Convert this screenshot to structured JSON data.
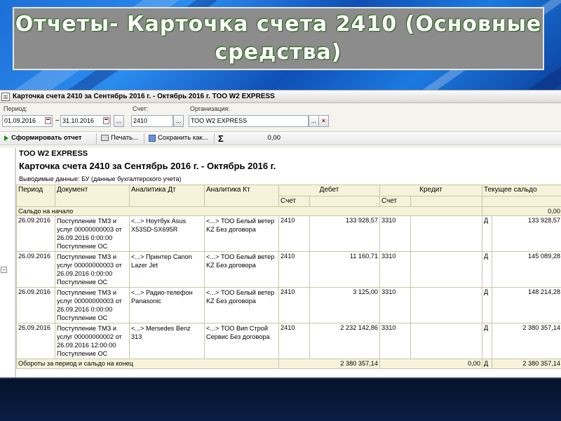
{
  "slide": {
    "title_line1": "Отчеты- Карточка счета 2410 (Основные",
    "title_line2": "средства)"
  },
  "window": {
    "title": "Карточка счета 2410 за Сентябрь 2016 г. - Октябрь 2016 г. ТОО W2 EXPRESS"
  },
  "params": {
    "period_label": "Период:",
    "date_from": "01.09.2016",
    "date_to": "31.10.2016",
    "dots_label": "...",
    "account_label": "Счет:",
    "account_value": "2410",
    "org_label": "Организация:",
    "org_value": "ТОО W2 EXPRESS",
    "clear_label": "×"
  },
  "toolbar": {
    "generate_label": "Сформировать отчет",
    "print_label": "Печать...",
    "save_label": "Сохранить как...",
    "sigma": "Σ",
    "sum_value": "0,00"
  },
  "report": {
    "org": "ТОО W2 EXPRESS",
    "title": "Карточка счета 2410 за Сентябрь 2016 г. - Октябрь 2016 г.",
    "output_data": "Выводимые данные:  БУ (данные бухгалтерского учета)",
    "headers": {
      "period": "Период",
      "document": "Документ",
      "analytics_dt": "Аналитика Дт",
      "analytics_kt": "Аналитика Кт",
      "debit": "Дебет",
      "credit": "Кредит",
      "balance": "Текущее сальдо",
      "debit_account": "Счет",
      "credit_account": "Счет"
    },
    "opening": {
      "label": "Сальдо на начало",
      "value": "0,00"
    },
    "rows": [
      {
        "date": "26.09.2016",
        "document": "Поступление ТМЗ и услуг 00000000003 от 26.09.2016 0:00:00 Поступление ОС",
        "analytics_dt": "<...> Ноутбук Asus X53SD-SX695R",
        "analytics_kt": "<...> ТОО Белый ветер KZ Без договора",
        "debit_account": "2410",
        "debit_sum": "133 928,57",
        "credit_account": "3310",
        "credit_sum": "",
        "balance_side": "Д",
        "balance": "133 928,57"
      },
      {
        "date": "26.09.2016",
        "document": "Поступление ТМЗ и услуг 00000000003 от 26.09.2016 0:00:00 Поступление ОС",
        "analytics_dt": "<...> Принтер Canon Lazer Jet",
        "analytics_kt": "<...> ТОО Белый ветер KZ Без договора",
        "debit_account": "2410",
        "debit_sum": "11 160,71",
        "credit_account": "3310",
        "credit_sum": "",
        "balance_side": "Д",
        "balance": "145 089,28"
      },
      {
        "date": "26.09.2016",
        "document": "Поступление ТМЗ и услуг 00000000003 от 26.09.2016 0:00:00 Поступление ОС",
        "analytics_dt": "<...> Радио-телефон Panasonic",
        "analytics_kt": "<...> ТОО Белый ветер KZ Без договора",
        "debit_account": "2410",
        "debit_sum": "3 125,00",
        "credit_account": "3310",
        "credit_sum": "",
        "balance_side": "Д",
        "balance": "148 214,28"
      },
      {
        "date": "26.09.2016",
        "document": "Поступление ТМЗ и услуг 00000000002 от 26.09.2016 12:00:00 Поступление ОС",
        "analytics_dt": "<...> Mersedes Benz 313",
        "analytics_kt": "<...> ТОО Вип Строй Сервис Без договора",
        "debit_account": "2410",
        "debit_sum": "2 232 142,86",
        "credit_account": "3310",
        "credit_sum": "",
        "balance_side": "Д",
        "balance": "2 380 357,14"
      }
    ],
    "totals": {
      "label": "Обороты за период и сальдо на конец",
      "debit": "2 380 357,14",
      "credit": "0,00",
      "balance_side": "Д",
      "balance": "2 380 357,14"
    }
  }
}
